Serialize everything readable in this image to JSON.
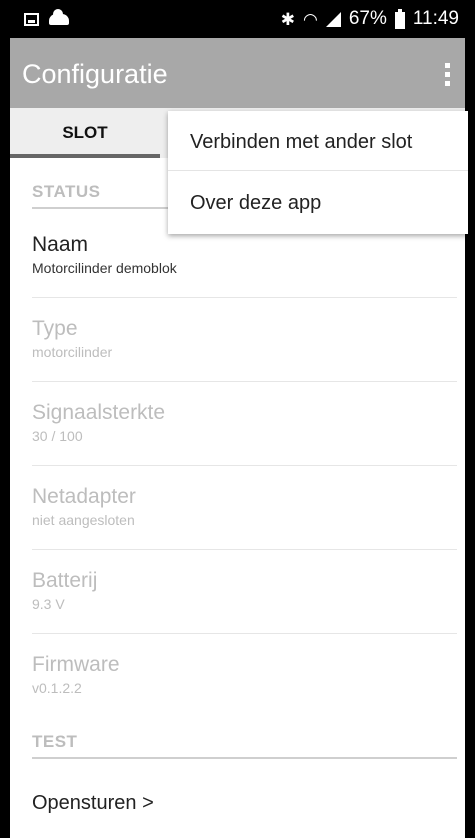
{
  "status_bar": {
    "left_icons": [
      "gallery-icon",
      "cloud-icon"
    ],
    "right_icons": [
      "bluetooth-icon",
      "wifi-icon",
      "signal-icon",
      "battery-icon"
    ],
    "battery_percent": "67%",
    "time": "11:49"
  },
  "app_bar": {
    "title": "Configuratie",
    "overflow_icon": "more-vert-icon",
    "background": "#a8a8a8"
  },
  "tabs": [
    {
      "label": "SLOT",
      "selected": true
    }
  ],
  "sections": {
    "status_header": "STATUS",
    "test_header": "TEST"
  },
  "items": [
    {
      "title": "Naam",
      "value": "Motorcilinder demoblok",
      "enabled": true
    },
    {
      "title": "Type",
      "value": "motorcilinder",
      "enabled": false
    },
    {
      "title": "Signaalsterkte",
      "value": "30 / 100",
      "enabled": false
    },
    {
      "title": "Netadapter",
      "value": "niet aangesloten",
      "enabled": false
    },
    {
      "title": "Batterij",
      "value": "9.3 V",
      "enabled": false
    },
    {
      "title": "Firmware",
      "value": "v0.1.2.2",
      "enabled": false
    }
  ],
  "test_action": "Opensturen >",
  "menu": {
    "items": [
      "Verbinden met ander slot",
      "Over deze app"
    ]
  }
}
